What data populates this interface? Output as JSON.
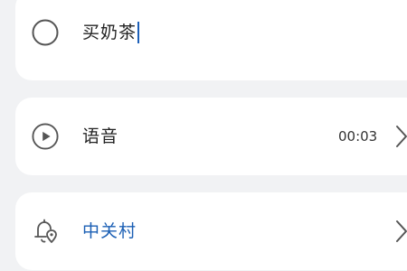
{
  "task": {
    "title": "买奶茶",
    "checkbox_icon": "circle-outline-icon"
  },
  "voice": {
    "label": "语音",
    "duration": "00:03",
    "play_icon": "play-circle-icon",
    "chevron_icon": "chevron-right-icon"
  },
  "location": {
    "label": "中关村",
    "icon": "bell-location-icon",
    "chevron_icon": "chevron-right-icon"
  },
  "colors": {
    "background": "#f1f2f4",
    "card": "#ffffff",
    "accent_blue": "#1b5fb4",
    "icon_gray": "#555555"
  }
}
